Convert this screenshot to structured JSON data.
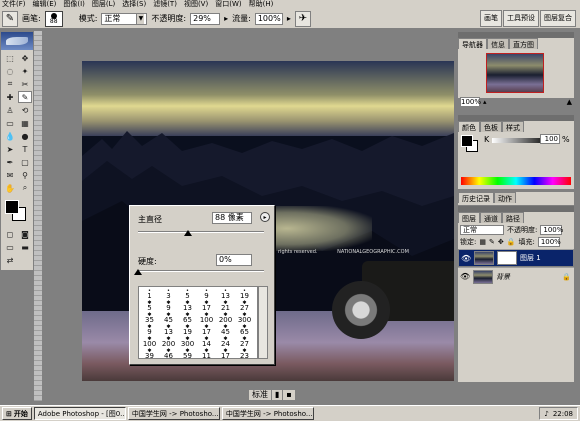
{
  "menu": [
    "文件(F)",
    "编辑(E)",
    "图像(I)",
    "图层(L)",
    "选择(S)",
    "滤镜(T)",
    "视图(V)",
    "窗口(W)",
    "帮助(H)"
  ],
  "options": {
    "brush_label": "画笔:",
    "brush_size": "88",
    "mode_label": "模式:",
    "mode_value": "正常",
    "opacity_label": "不透明度:",
    "opacity_value": "29%",
    "flow_label": "流量:",
    "flow_value": "100%"
  },
  "palette_well": [
    "画笔",
    "工具预设",
    "图层复合"
  ],
  "brush_popup": {
    "diameter_label": "主直径",
    "diameter_value": "88 像素",
    "hardness_label": "硬度:",
    "hardness_value": "0%",
    "presets": [
      {
        "size": "1"
      },
      {
        "size": "3"
      },
      {
        "size": "5"
      },
      {
        "size": "9"
      },
      {
        "size": "13"
      },
      {
        "size": "19"
      },
      {
        "size": "5"
      },
      {
        "size": "9"
      },
      {
        "size": "13"
      },
      {
        "size": "17"
      },
      {
        "size": "21"
      },
      {
        "size": "27"
      },
      {
        "size": "35"
      },
      {
        "size": "45"
      },
      {
        "size": "65"
      },
      {
        "size": "100"
      },
      {
        "size": "200"
      },
      {
        "size": "300"
      },
      {
        "size": "9"
      },
      {
        "size": "13"
      },
      {
        "size": "19"
      },
      {
        "size": "17"
      },
      {
        "size": "45"
      },
      {
        "size": "65"
      },
      {
        "size": "100"
      },
      {
        "size": "200"
      },
      {
        "size": "300"
      },
      {
        "size": "14"
      },
      {
        "size": "24"
      },
      {
        "size": "27"
      },
      {
        "size": "39"
      },
      {
        "size": "46"
      },
      {
        "size": "59"
      },
      {
        "size": "11"
      },
      {
        "size": "17"
      },
      {
        "size": "23"
      }
    ]
  },
  "canvas": {
    "watermark": "rights reserved.",
    "brand": "NATIONALGEOGRAPHIC.COM"
  },
  "bottom_bar": {
    "label": "标准"
  },
  "navigator": {
    "tabs": [
      "导航器",
      "信息",
      "直方图"
    ],
    "zoom": "100%"
  },
  "color_panel": {
    "tabs": [
      "颜色",
      "色板",
      "样式"
    ],
    "channel": "K",
    "value": "100",
    "unit": "%"
  },
  "history_panel": {
    "tabs": [
      "历史记录",
      "动作"
    ]
  },
  "layers_panel": {
    "tabs": [
      "图层",
      "通道",
      "路径"
    ],
    "blend_mode": "正常",
    "opacity_label": "不透明度:",
    "opacity_value": "100%",
    "lock_label": "锁定:",
    "fill_label": "填充:",
    "fill_value": "100%",
    "layers": [
      {
        "name": "图层 1"
      },
      {
        "name": "背景"
      }
    ]
  },
  "taskbar": {
    "start": "开始",
    "buttons": [
      "Adobe Photoshop - [图0...",
      "中国学生网 -> Photosho...",
      "中国学生网 -> Photosho..."
    ],
    "time": "22:08"
  },
  "colors": {
    "selection": "#0a246a",
    "chrome": "#d4d0c8"
  }
}
